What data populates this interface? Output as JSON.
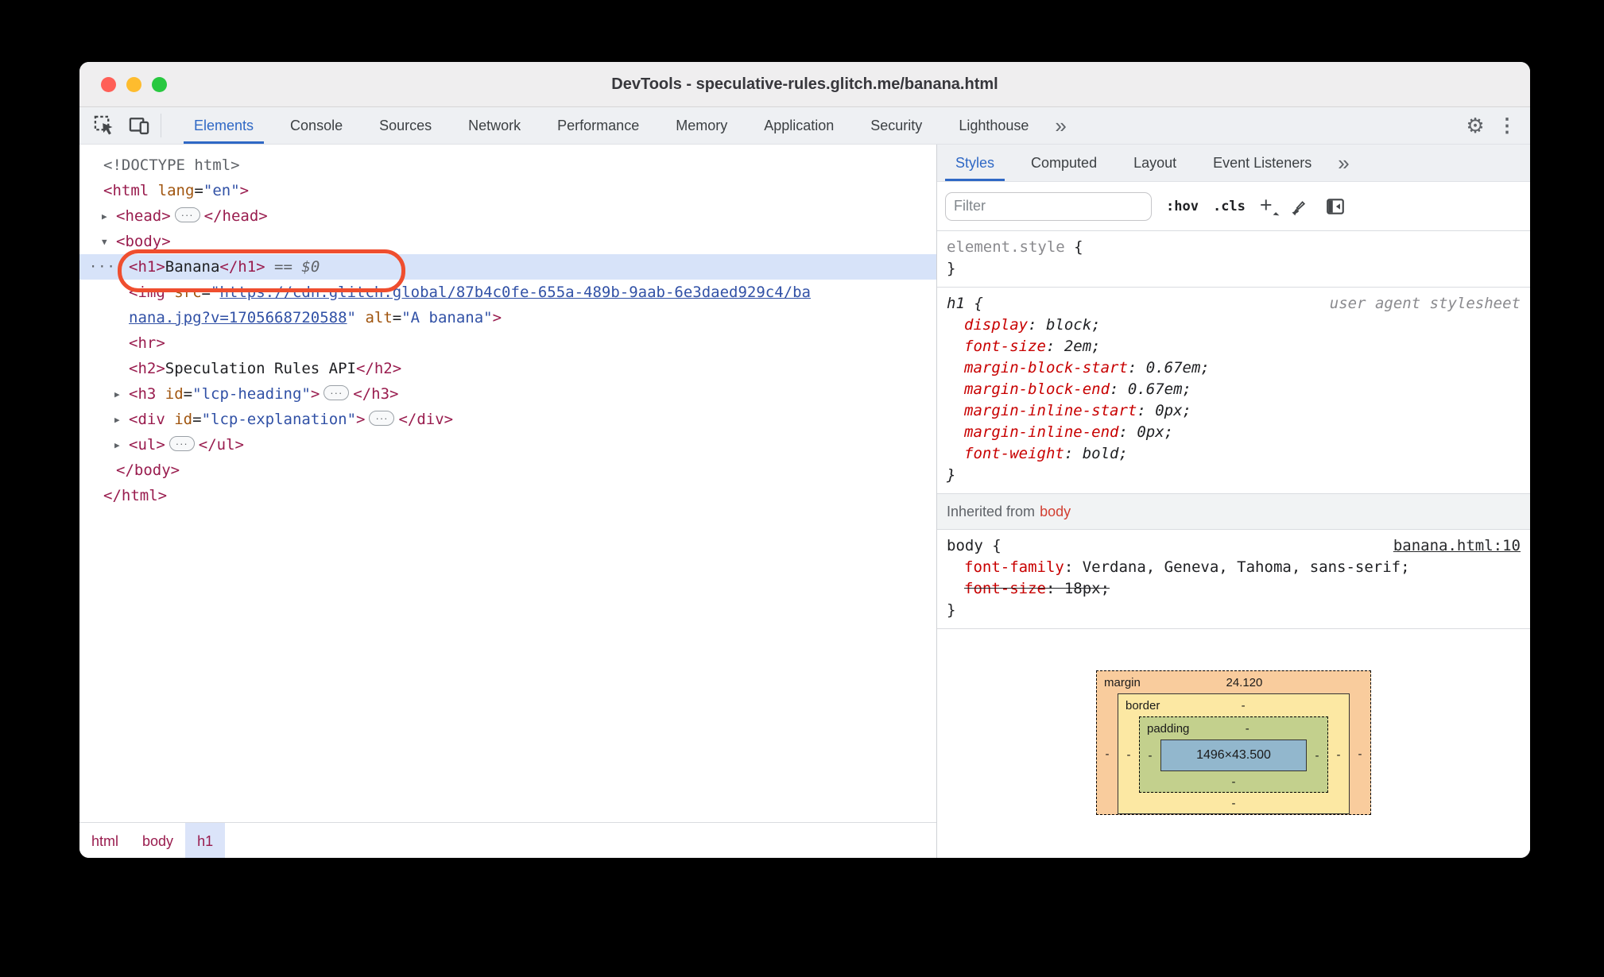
{
  "window": {
    "title": "DevTools - speculative-rules.glitch.me/banana.html"
  },
  "colors": {
    "accent": "#2f68c5",
    "tag": "#991c4e",
    "attr": "#a0550f",
    "value": "#3151a6",
    "selection": "#d7e3f9",
    "annotation": "#ef4e2f",
    "property": "#c80000"
  },
  "toolbar": {
    "tabs": [
      "Elements",
      "Console",
      "Sources",
      "Network",
      "Performance",
      "Memory",
      "Application",
      "Security",
      "Lighthouse"
    ],
    "selected": "Elements",
    "overflow_label": "»",
    "gear_label": "⚙",
    "kebab_label": "⋮"
  },
  "dom_tree": {
    "rows": [
      {
        "indent": 0,
        "segments": [
          {
            "c": "g",
            "t": "<!DOCTYPE html>"
          }
        ]
      },
      {
        "indent": 0,
        "segments": [
          {
            "c": "t",
            "t": "<html"
          },
          {
            "c": "x",
            "t": " "
          },
          {
            "c": "a",
            "t": "lang"
          },
          {
            "c": "x",
            "t": "="
          },
          {
            "c": "v",
            "t": "\"en\""
          },
          {
            "c": "t",
            "t": ">"
          }
        ]
      },
      {
        "indent": 1,
        "arrow": "right",
        "segments": [
          {
            "c": "t",
            "t": "<head>"
          },
          {
            "c": "p",
            "t": "···"
          },
          {
            "c": "t",
            "t": "</head>"
          }
        ]
      },
      {
        "indent": 1,
        "arrow": "down",
        "segments": [
          {
            "c": "t",
            "t": "<body>"
          }
        ]
      },
      {
        "indent": 2,
        "selected": true,
        "annotated": true,
        "segments": [
          {
            "c": "t",
            "t": "<h1>"
          },
          {
            "c": "x",
            "t": "Banana"
          },
          {
            "c": "t",
            "t": "</h1>"
          },
          {
            "c": "e",
            "t": " == "
          },
          {
            "c": "d",
            "t": "$0"
          }
        ]
      },
      {
        "indent": 2,
        "segments": [
          {
            "c": "t",
            "t": "<img"
          },
          {
            "c": "x",
            "t": " "
          },
          {
            "c": "a",
            "t": "src"
          },
          {
            "c": "x",
            "t": "="
          },
          {
            "c": "v",
            "t": "\""
          },
          {
            "c": "l",
            "t": "https://cdn.glitch.global/87b4c0fe-655a-489b-9aab-6e3daed929c4/ba"
          }
        ]
      },
      {
        "indent": 2,
        "segments": [
          {
            "c": "l",
            "t": "nana.jpg?v=1705668720588"
          },
          {
            "c": "v",
            "t": "\""
          },
          {
            "c": "x",
            "t": " "
          },
          {
            "c": "a",
            "t": "alt"
          },
          {
            "c": "x",
            "t": "="
          },
          {
            "c": "v",
            "t": "\"A banana\""
          },
          {
            "c": "t",
            "t": ">"
          }
        ]
      },
      {
        "indent": 2,
        "segments": [
          {
            "c": "t",
            "t": "<hr>"
          }
        ]
      },
      {
        "indent": 2,
        "segments": [
          {
            "c": "t",
            "t": "<h2>"
          },
          {
            "c": "x",
            "t": "Speculation Rules API"
          },
          {
            "c": "t",
            "t": "</h2>"
          }
        ]
      },
      {
        "indent": 2,
        "arrow": "right",
        "segments": [
          {
            "c": "t",
            "t": "<h3"
          },
          {
            "c": "x",
            "t": " "
          },
          {
            "c": "a",
            "t": "id"
          },
          {
            "c": "x",
            "t": "="
          },
          {
            "c": "v",
            "t": "\"lcp-heading\""
          },
          {
            "c": "t",
            "t": ">"
          },
          {
            "c": "p",
            "t": "···"
          },
          {
            "c": "t",
            "t": "</h3>"
          }
        ]
      },
      {
        "indent": 2,
        "arrow": "right",
        "segments": [
          {
            "c": "t",
            "t": "<div"
          },
          {
            "c": "x",
            "t": " "
          },
          {
            "c": "a",
            "t": "id"
          },
          {
            "c": "x",
            "t": "="
          },
          {
            "c": "v",
            "t": "\"lcp-explanation\""
          },
          {
            "c": "t",
            "t": ">"
          },
          {
            "c": "p",
            "t": "···"
          },
          {
            "c": "t",
            "t": "</div>"
          }
        ]
      },
      {
        "indent": 2,
        "arrow": "right",
        "segments": [
          {
            "c": "t",
            "t": "<ul>"
          },
          {
            "c": "p",
            "t": "···"
          },
          {
            "c": "t",
            "t": "</ul>"
          }
        ]
      },
      {
        "indent": 1,
        "segments": [
          {
            "c": "t",
            "t": "</body>"
          }
        ]
      },
      {
        "indent": 0,
        "segments": [
          {
            "c": "t",
            "t": "</html>"
          }
        ]
      }
    ]
  },
  "breadcrumb": {
    "items": [
      "html",
      "body",
      "h1"
    ],
    "selected": "h1"
  },
  "sidebar": {
    "tabs": [
      "Styles",
      "Computed",
      "Layout",
      "Event Listeners"
    ],
    "selected": "Styles",
    "overflow_label": "»",
    "filter_placeholder": "Filter",
    "hov_label": ":hov",
    "cls_label": ".cls",
    "plus_label": "+"
  },
  "styles": {
    "rules": [
      {
        "selector": "element.style",
        "selector_gray": true,
        "italic": false,
        "origin": "",
        "declarations": []
      },
      {
        "selector": "h1",
        "selector_gray": false,
        "italic": true,
        "origin": "user agent stylesheet",
        "origin_link": false,
        "declarations": [
          {
            "prop": "display",
            "value": "block"
          },
          {
            "prop": "font-size",
            "value": "2em"
          },
          {
            "prop": "margin-block-start",
            "value": "0.67em"
          },
          {
            "prop": "margin-block-end",
            "value": "0.67em"
          },
          {
            "prop": "margin-inline-start",
            "value": "0px"
          },
          {
            "prop": "margin-inline-end",
            "value": "0px"
          },
          {
            "prop": "font-weight",
            "value": "bold"
          }
        ]
      },
      {
        "header_before": "Inherited from ",
        "header_link": "body",
        "selector": "body",
        "selector_gray": false,
        "italic": false,
        "origin": "banana.html:10",
        "origin_link": true,
        "declarations": [
          {
            "prop": "font-family",
            "value": "Verdana, Geneva, Tahoma, sans-serif"
          },
          {
            "prop": "font-size",
            "value": "18px",
            "struck": true
          }
        ]
      }
    ]
  },
  "box_model": {
    "margin_label": "margin",
    "margin_top": "24.120",
    "margin_left": "-",
    "margin_right": "-",
    "border_label": "border",
    "border_top": "-",
    "border_left": "-",
    "border_right": "-",
    "border_bottom": "-",
    "padding_label": "padding",
    "padding_top": "-",
    "padding_left": "-",
    "padding_right": "-",
    "padding_bottom": "-",
    "content": "1496×43.500"
  }
}
